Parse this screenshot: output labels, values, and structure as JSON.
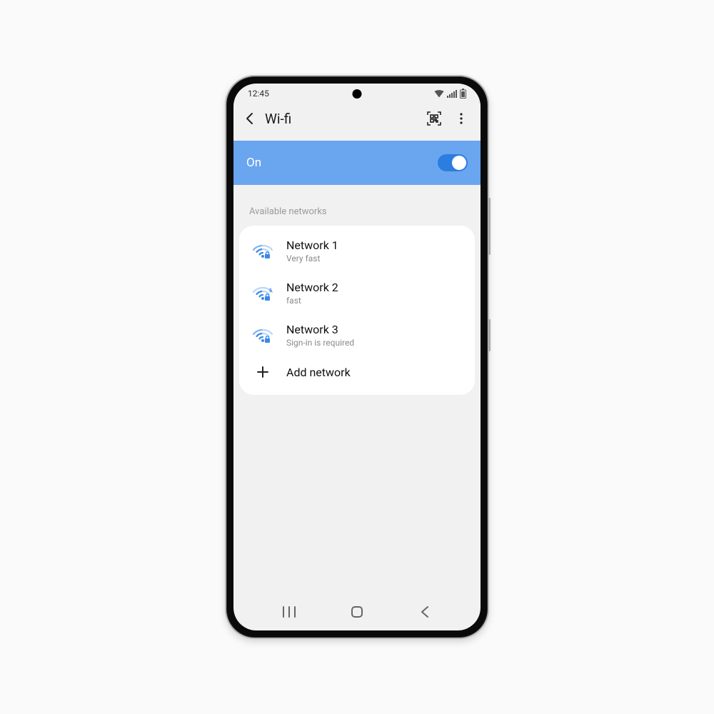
{
  "status": {
    "time": "12:45"
  },
  "header": {
    "title": "Wi-fi"
  },
  "toggle": {
    "label": "On",
    "state": true
  },
  "section": {
    "label": "Available networks"
  },
  "networks": [
    {
      "name": "Network 1",
      "sub": "Very fast",
      "secure": true,
      "badge": ""
    },
    {
      "name": "Network 2",
      "sub": "fast",
      "secure": true,
      "badge": "6"
    },
    {
      "name": "Network 3",
      "sub": "Sign-in is required",
      "secure": true,
      "badge": ""
    }
  ],
  "add": {
    "label": "Add network"
  },
  "colors": {
    "accent": "#6aa5f0",
    "wifi": "#3b88e6"
  }
}
